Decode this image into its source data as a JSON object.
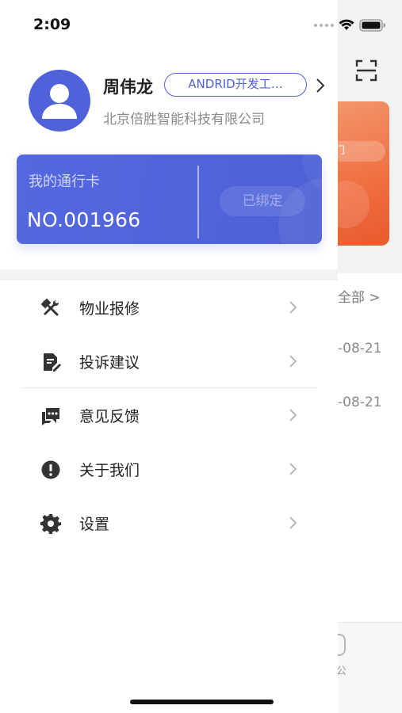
{
  "status_bar": {
    "time": "2:09"
  },
  "profile": {
    "name": "周伟龙",
    "role": "ANDRID开发工…",
    "company": "北京倍胜智能科技有限公司"
  },
  "pass_card": {
    "title": "我的通行卡",
    "number": "NO.001966",
    "status": "已绑定"
  },
  "menu": [
    {
      "label": "物业报修",
      "icon": "tools-icon"
    },
    {
      "label": "投诉建议",
      "icon": "document-edit-icon"
    },
    {
      "label": "意见反馈",
      "icon": "feedback-chat-icon"
    },
    {
      "label": "关于我们",
      "icon": "info-exclamation-icon"
    },
    {
      "label": "设置",
      "icon": "gear-icon"
    }
  ],
  "background": {
    "banner_text": "门",
    "view_all": "全部 >",
    "dates": [
      "-08-21",
      "-08-21"
    ],
    "tab_text": "公"
  },
  "colors": {
    "accent": "#4f62d9",
    "banner": "#ef6d3f"
  }
}
